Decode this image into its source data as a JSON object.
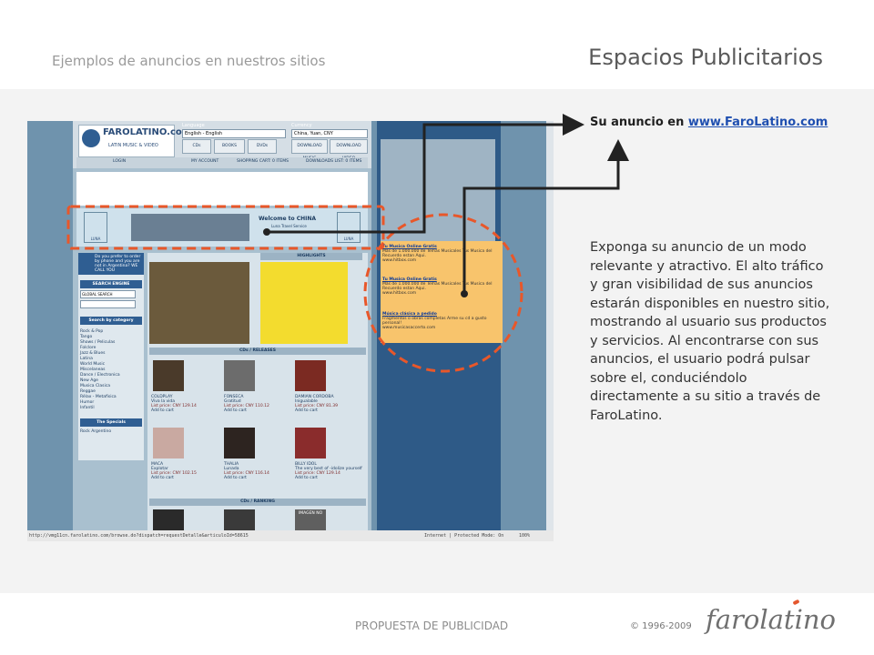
{
  "slide": {
    "subtitle": "Ejemplos de anuncios en nuestros sitios",
    "title": "Espacios Publicitarios",
    "footer_doc": "PROPUESTA DE PUBLICIDAD",
    "footer_copyright": "© 1996-2009",
    "logo_text": "farolatino"
  },
  "callout": {
    "prefix": "Su anuncio en ",
    "link": "www.FaroLatino.com"
  },
  "description": "Exponga su anuncio de un modo relevante y atractivo. El alto tráfico y gran visibilidad de sus anuncios estarán disponibles en nuestro sitio, mostrando al usuario sus productos y servicios. Al encontrarse con sus anuncios, el usuario podrá pulsar sobre el, conduciéndolo directamente a su sitio a través de FaroLatino.",
  "screenshot": {
    "logo_brand": "FAROLATINO.com",
    "logo_sub": "LATIN MUSIC & VIDEO",
    "language_label": "Language",
    "language_value": "English - English",
    "currency_label": "Currency",
    "currency_value": "China, Yuan, CNY",
    "nav": [
      "CDs",
      "BOOKS",
      "DVDs",
      "DOWNLOAD MUSIC",
      "DOWNLOAD VIDEO"
    ],
    "links": [
      "LOGIN",
      "MY ACCOUNT",
      "SHOPPING CART: 0 ITEMS",
      "DOWNLOADS LIST: 0 ITEMS"
    ],
    "banner_title": "Welcome to CHINA",
    "banner_sub": "Luna Travel Service",
    "banner_luna": "LUNA",
    "call_text": "Do you prefer to order by phone and you are not in Argentina? WE CALL YOU",
    "search_head": "SEARCH ENGINE",
    "search_value": "GLOBAL SEARCH",
    "category_head": "Search by category",
    "categories": [
      "Rock & Pop",
      "Tango",
      "Shows / Peliculas",
      "Folclore",
      "Jazz & Blues",
      "Latina",
      "World Music",
      "Miscelaneas",
      "Dance / Electronica",
      "New Age",
      "Musica Clasica",
      "Reggae",
      "Rélax - Metafisica",
      "Humor",
      "Infantil"
    ],
    "specials_head": "The Specials",
    "specials_item": "Rock Argentino",
    "tab_highlights": "HIGHLIGHTS",
    "tab_releases": "CDs / RELEASES",
    "tab_ranking": "CDs / RANKING",
    "releases": [
      {
        "artist": "COLDPLAY",
        "title": "Viva la vida",
        "price": "List price: CNY 129.14",
        "action": "Add to cart"
      },
      {
        "artist": "FONSECA",
        "title": "Gratitud",
        "price": "List price: CNY 110.12",
        "action": "Add to cart"
      },
      {
        "artist": "DAMIAN CORDOBA",
        "title": "Inigualable",
        "price": "List price: CNY 81.39",
        "action": "Add to cart"
      },
      {
        "artist": "MACA",
        "title": "Explotar",
        "price": "List price: CNY 102.15",
        "action": "Add to cart"
      },
      {
        "artist": "THALIA",
        "title": "Lunada",
        "price": "List price: CNY 116.14",
        "action": "Add to cart"
      },
      {
        "artist": "BILLY IDOL",
        "title": "The very best of -idolize yourself",
        "price": "List price: CNY 129.14",
        "action": "Add to cart"
      }
    ],
    "image_missing": "IMAGEN NO",
    "ads": [
      {
        "title": "Tu Musica Online Gratis",
        "body": "Más de 1.000.000 de Temas Musicales Tus Musica del Recuerdo estan Aqui.",
        "url": "www.hitbox.com"
      },
      {
        "title": "Tu Musica Online Gratis",
        "body": "Más de 1.000.000 de Temas Musicales Tus Musica del Recuerdo estan Aqui.",
        "url": "www.hitbox.com"
      },
      {
        "title": "Música clásica a pedido",
        "body": "Fragmentos o obras completas Arme su cd a gusto personal!",
        "url": "www.musicasaccerto.com"
      }
    ],
    "status_url": "http://vmg11cn.farolatino.com/browse.do?dispatch=requestDetalle&articuloId=58615",
    "status_zone": "Internet | Protected Mode: On",
    "status_zoom": "100%"
  },
  "colors": {
    "band": "#f3f3f3",
    "highlight_dash": "#e8572a",
    "arrow": "#222222"
  }
}
